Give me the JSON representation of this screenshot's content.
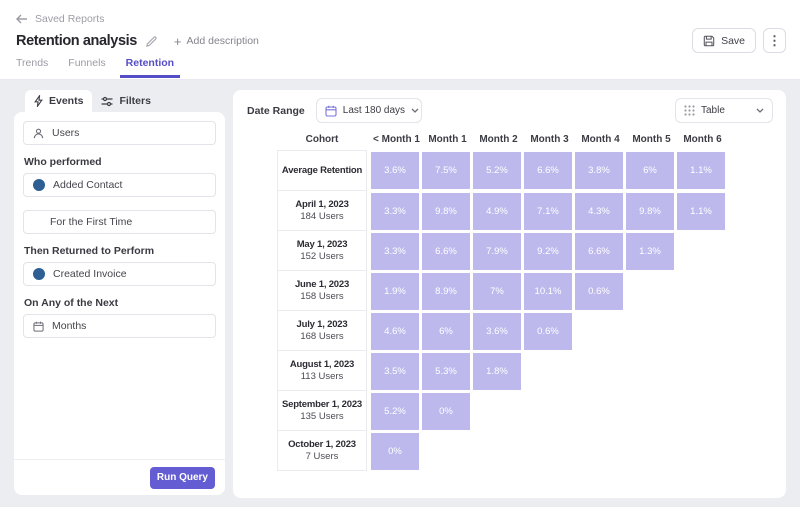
{
  "header": {
    "back": "Saved Reports",
    "title": "Retention analysis",
    "add_description": "Add description",
    "save": "Save",
    "nav_tabs": [
      "Trends",
      "Funnels",
      "Retention"
    ],
    "active_tab": "Retention"
  },
  "query_panel": {
    "events_tab": "Events",
    "filters_tab": "Filters",
    "users": "Users",
    "who_performed": "Who performed",
    "first_event": "Added Contact",
    "first_time": "For the First Time",
    "then_returned": "Then Returned to Perform",
    "return_event": "Created Invoice",
    "on_any": "On Any of the Next",
    "unit": "Months",
    "run_query": "Run Query"
  },
  "toolbar": {
    "date_range_label": "Date Range",
    "date_range_value": "Last 180 days",
    "view_selector": "Table"
  },
  "colors": {
    "accent": "#554dc5",
    "heatmap_cell": "#bdb9ed",
    "event_dot": "#2d5f94",
    "run_button": "#635cd3"
  },
  "chart_data": {
    "type": "table",
    "title": "Retention analysis",
    "columns": [
      "Cohort",
      "< Month 1",
      "Month 1",
      "Month 2",
      "Month 3",
      "Month 4",
      "Month 5",
      "Month 6"
    ],
    "rows": [
      {
        "cohort": "Average Retention",
        "users": "",
        "values": [
          "3.6%",
          "7.5%",
          "5.2%",
          "6.6%",
          "3.8%",
          "6%",
          "1.1%"
        ]
      },
      {
        "cohort": "April 1, 2023",
        "users": "184 Users",
        "values": [
          "3.3%",
          "9.8%",
          "4.9%",
          "7.1%",
          "4.3%",
          "9.8%",
          "1.1%"
        ]
      },
      {
        "cohort": "May 1, 2023",
        "users": "152 Users",
        "values": [
          "3.3%",
          "6.6%",
          "7.9%",
          "9.2%",
          "6.6%",
          "1.3%"
        ]
      },
      {
        "cohort": "June 1, 2023",
        "users": "158 Users",
        "values": [
          "1.9%",
          "8.9%",
          "7%",
          "10.1%",
          "0.6%"
        ]
      },
      {
        "cohort": "July 1, 2023",
        "users": "168 Users",
        "values": [
          "4.6%",
          "6%",
          "3.6%",
          "0.6%"
        ]
      },
      {
        "cohort": "August 1, 2023",
        "users": "113 Users",
        "values": [
          "3.5%",
          "5.3%",
          "1.8%"
        ]
      },
      {
        "cohort": "September 1, 2023",
        "users": "135 Users",
        "values": [
          "5.2%",
          "0%"
        ]
      },
      {
        "cohort": "October 1, 2023",
        "users": "7 Users",
        "values": [
          "0%"
        ]
      }
    ]
  }
}
